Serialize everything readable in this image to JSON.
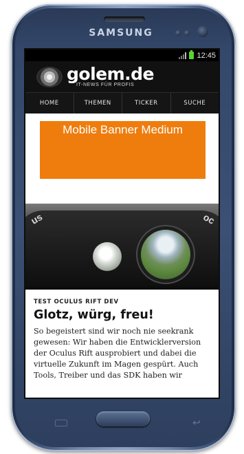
{
  "device": {
    "brand": "SAMSUNG"
  },
  "status_bar": {
    "time": "12:45"
  },
  "site": {
    "name": "golem.de",
    "tagline": "IT-NEWS FÜR PROFIS"
  },
  "nav": {
    "items": [
      {
        "label": "HOME"
      },
      {
        "label": "THEMEN"
      },
      {
        "label": "TICKER"
      },
      {
        "label": "SUCHE"
      }
    ]
  },
  "banner": {
    "label": "Mobile Banner Medium",
    "color": "#ee7d0d"
  },
  "article": {
    "kicker": "TEST OCULUS RIFT DEV",
    "title": "Glotz, würg, freu!",
    "teaser": "So begeistert sind wir noch nie seekrank gewesen: Wir haben die Entwicklerversion der Oculus Rift ausprobiert und dabei die virtuelle Zukunft im Magen gespürt. Auch Tools, Treiber und das SDK haben wir"
  }
}
